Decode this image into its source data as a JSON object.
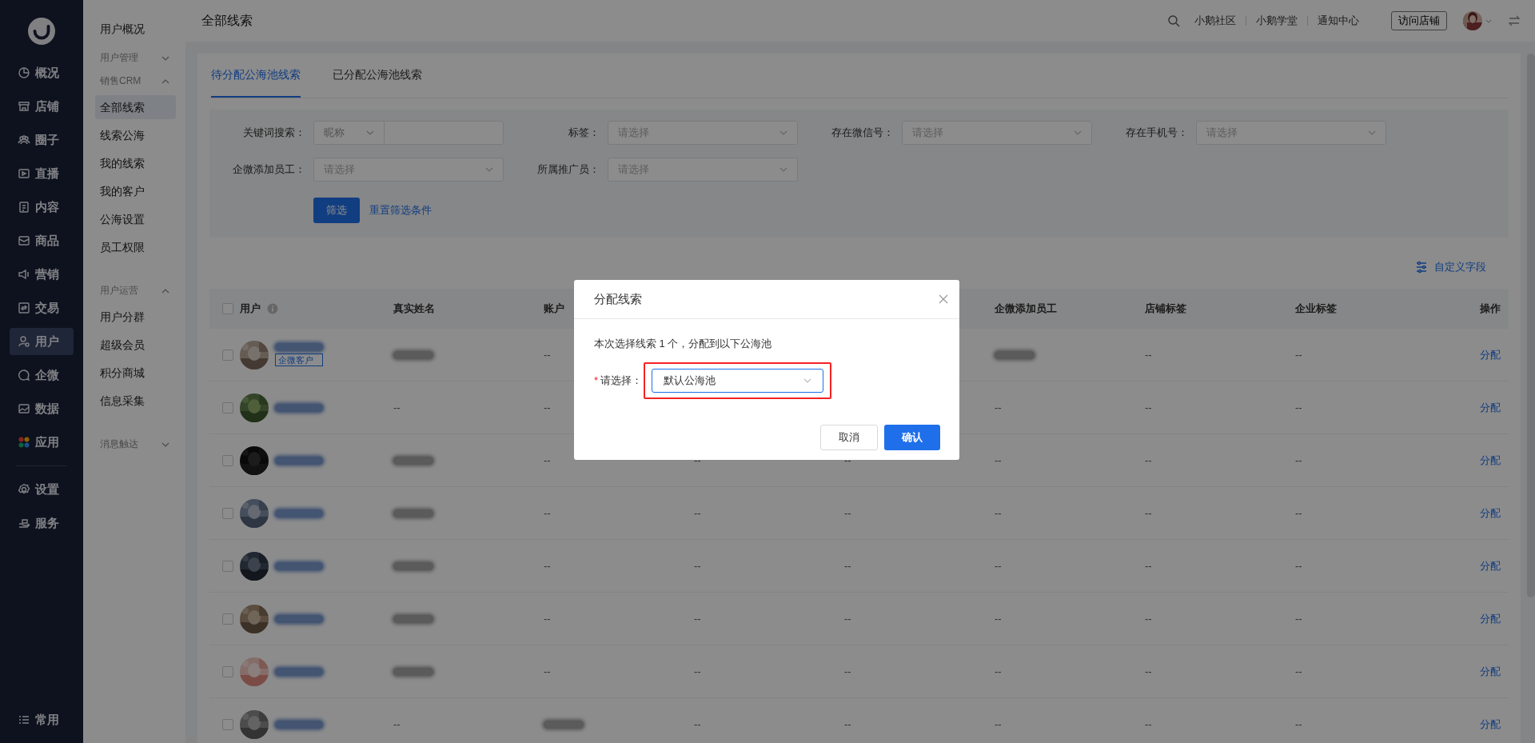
{
  "sidebar": {
    "items": [
      {
        "label": "概况",
        "selected": false
      },
      {
        "label": "店铺",
        "selected": false
      },
      {
        "label": "圈子",
        "selected": false
      },
      {
        "label": "直播",
        "selected": false
      },
      {
        "label": "内容",
        "selected": false
      },
      {
        "label": "商品",
        "selected": false
      },
      {
        "label": "营销",
        "selected": false
      },
      {
        "label": "交易",
        "selected": false
      },
      {
        "label": "用户",
        "selected": true
      },
      {
        "label": "企微",
        "selected": false
      },
      {
        "label": "数据",
        "selected": false
      },
      {
        "label": "应用",
        "selected": false
      }
    ],
    "lower_items": [
      {
        "label": "设置",
        "selected": false
      },
      {
        "label": "服务",
        "selected": false
      }
    ],
    "bottom_item": {
      "label": "常用"
    }
  },
  "submenu": {
    "top_item": {
      "label": "用户概况",
      "selected": false
    },
    "groups": [
      {
        "title": "用户管理",
        "expanded": false
      },
      {
        "title": "销售CRM",
        "expanded": true,
        "items": [
          {
            "label": "全部线索",
            "selected": true
          },
          {
            "label": "线索公海",
            "selected": false
          },
          {
            "label": "我的线索",
            "selected": false
          },
          {
            "label": "我的客户",
            "selected": false
          },
          {
            "label": "公海设置",
            "selected": false
          },
          {
            "label": "员工权限",
            "selected": false
          }
        ]
      },
      {
        "title": "用户运营",
        "expanded": true,
        "items": [
          {
            "label": "用户分群",
            "selected": false
          },
          {
            "label": "超级会员",
            "selected": false
          },
          {
            "label": "积分商城",
            "selected": false
          },
          {
            "label": "信息采集",
            "selected": false
          }
        ]
      },
      {
        "title": "消息触达",
        "expanded": false
      }
    ]
  },
  "header": {
    "title": "全部线索",
    "links": [
      "小鹅社区",
      "小鹅学堂",
      "通知中心"
    ],
    "visit_button": "访问店铺"
  },
  "tabs": [
    {
      "label": "待分配公海池线索",
      "selected": true
    },
    {
      "label": "已分配公海池线索",
      "selected": false
    }
  ],
  "filters": [
    {
      "kind": "keyword",
      "label": "关键词搜索：",
      "value": "昵称"
    },
    {
      "kind": "select",
      "label": "标签：",
      "placeholder": "请选择"
    },
    {
      "kind": "select",
      "label": "存在微信号：",
      "placeholder": "请选择"
    },
    {
      "kind": "select",
      "label": "存在手机号：",
      "placeholder": "请选择"
    },
    {
      "kind": "select",
      "label": "企微添加员工：",
      "placeholder": "请选择"
    },
    {
      "kind": "select",
      "label": "所属推广员：",
      "placeholder": "请选择"
    }
  ],
  "filter_button": "筛选",
  "reset_link": "重置筛选条件",
  "custom_fields_link": "自定义字段",
  "table": {
    "all_checked": false,
    "columns": [
      {
        "label": "用户"
      },
      {
        "label": "真实姓名"
      },
      {
        "label": "账户"
      },
      {},
      {},
      {
        "label": "企微添加员工"
      },
      {
        "label": "店铺标签"
      },
      {
        "label": "企业标签"
      },
      {
        "label": "操作"
      }
    ],
    "rows": [
      {
        "checked": false,
        "cells": [
          {
            "name_redacted": true,
            "badge": "企微客户"
          },
          {
            "redacted": true
          },
          {
            "text": "--"
          },
          {},
          {},
          {
            "redacted": true
          },
          {
            "text": "--"
          },
          {
            "text": "--"
          },
          {
            "text": "分配",
            "kind": "link"
          }
        ]
      },
      {
        "checked": false,
        "cells": [
          {
            "name_redacted": true
          },
          {
            "text": "--"
          },
          {
            "text": "--"
          },
          {},
          {},
          {
            "text": "--"
          },
          {
            "text": "--"
          },
          {
            "text": "--"
          },
          {
            "text": "分配",
            "kind": "link"
          }
        ]
      },
      {
        "checked": false,
        "cells": [
          {
            "name_redacted": true
          },
          {
            "redacted": true
          },
          {
            "text": "--"
          },
          {
            "text": "--"
          },
          {
            "text": "--"
          },
          {
            "text": "--"
          },
          {
            "text": "--"
          },
          {
            "text": "--"
          },
          {
            "text": "分配",
            "kind": "link"
          }
        ]
      },
      {
        "checked": false,
        "cells": [
          {
            "name_redacted": true
          },
          {
            "redacted": true
          },
          {
            "text": "--"
          },
          {
            "text": "--"
          },
          {
            "text": "--"
          },
          {
            "text": "--"
          },
          {
            "text": "--"
          },
          {
            "text": "--"
          },
          {
            "text": "分配",
            "kind": "link"
          }
        ]
      },
      {
        "checked": false,
        "cells": [
          {
            "name_redacted": true
          },
          {
            "redacted": true
          },
          {
            "text": "--"
          },
          {
            "text": "--"
          },
          {
            "text": "--"
          },
          {
            "text": "--"
          },
          {
            "text": "--"
          },
          {
            "text": "--"
          },
          {
            "text": "分配",
            "kind": "link"
          }
        ]
      },
      {
        "checked": false,
        "cells": [
          {
            "name_redacted": true
          },
          {
            "redacted": true
          },
          {
            "text": "--"
          },
          {
            "text": "--"
          },
          {
            "text": "--"
          },
          {
            "text": "--"
          },
          {
            "text": "--"
          },
          {
            "text": "--"
          },
          {
            "text": "分配",
            "kind": "link"
          }
        ]
      },
      {
        "checked": false,
        "cells": [
          {
            "name_redacted": true
          },
          {
            "redacted": true
          },
          {
            "text": "--"
          },
          {
            "text": "--"
          },
          {
            "text": "--"
          },
          {
            "text": "--"
          },
          {
            "text": "--"
          },
          {
            "text": "--"
          },
          {
            "text": "分配",
            "kind": "link"
          }
        ]
      },
      {
        "checked": false,
        "cells": [
          {
            "name_redacted": true
          },
          {
            "text": "--"
          },
          {
            "redacted": true
          },
          {
            "text": "--"
          },
          {
            "text": "--"
          },
          {
            "text": "--"
          },
          {
            "text": "--"
          },
          {
            "text": "--"
          },
          {
            "text": "分配",
            "kind": "link"
          }
        ]
      }
    ]
  },
  "dialog": {
    "title": "分配线索",
    "message": "本次选择线索 1 个，分配到以下公海池",
    "field_label": "请选择：",
    "required_mark": "*",
    "value": "默认公海池",
    "highlighted": true,
    "cancel": "取消",
    "confirm": "确认"
  }
}
